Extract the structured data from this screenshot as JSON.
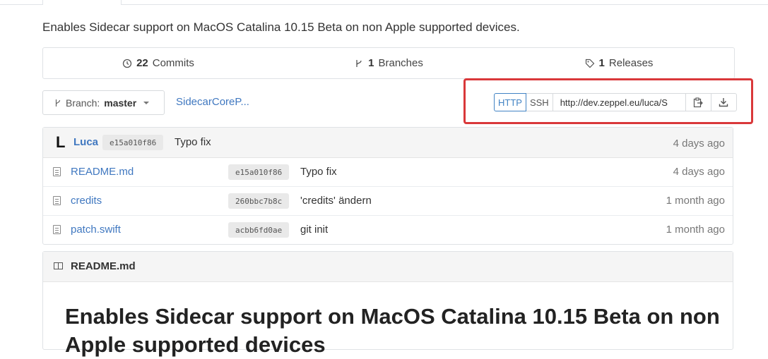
{
  "description": "Enables Sidecar support on MacOS Catalina 10.15 Beta on non Apple supported devices.",
  "stats": [
    {
      "count": "22",
      "label": "Commits",
      "icon": "history-icon"
    },
    {
      "count": "1",
      "label": "Branches",
      "icon": "branch-icon"
    },
    {
      "count": "1",
      "label": "Releases",
      "icon": "tag-icon"
    }
  ],
  "branch": {
    "prefix": "Branch:",
    "name": "master"
  },
  "breadcrumb": "SidecarCoreP...",
  "clone": {
    "http_label": "HTTP",
    "ssh_label": "SSH",
    "url": "http://dev.zeppel.eu/luca/S",
    "copy_icon": "clipboard-icon",
    "download_icon": "download-icon"
  },
  "latest_commit": {
    "author_initial": "L",
    "author": "Luca",
    "sha": "e15a010f86",
    "message": "Typo fix",
    "time": "4 days ago"
  },
  "files": [
    {
      "name": "README.md",
      "sha": "e15a010f86",
      "message": "Typo fix",
      "time": "4 days ago"
    },
    {
      "name": "credits",
      "sha": "260bbc7b8c",
      "message": "'credits' ändern",
      "time": "1 month ago"
    },
    {
      "name": "patch.swift",
      "sha": "acbb6fd0ae",
      "message": "git init",
      "time": "1 month ago"
    }
  ],
  "readme": {
    "filename": "README.md",
    "heading": "Enables Sidecar support on MacOS Catalina 10.15 Beta on non Apple supported devices"
  },
  "colors": {
    "link": "#4078c0",
    "highlight": "#d9383a",
    "active_protocol": "#4183c4"
  }
}
